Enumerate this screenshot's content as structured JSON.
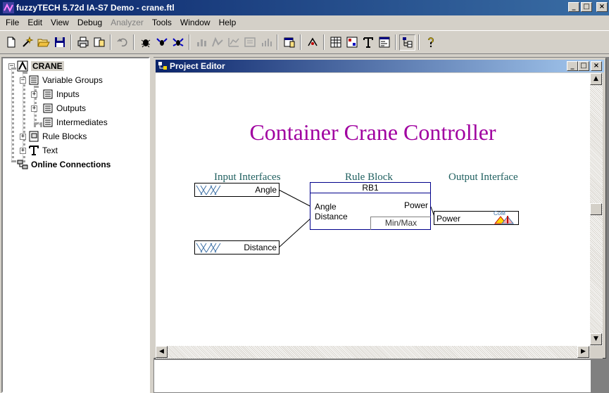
{
  "window": {
    "title": "fuzzyTECH 5.72d IA-S7 Demo - crane.ftl",
    "minimize": "_",
    "maximize": "□",
    "close": "×"
  },
  "menu": [
    {
      "label": "File",
      "enabled": true
    },
    {
      "label": "Edit",
      "enabled": true
    },
    {
      "label": "View",
      "enabled": true
    },
    {
      "label": "Debug",
      "enabled": true
    },
    {
      "label": "Analyzer",
      "enabled": false
    },
    {
      "label": "Tools",
      "enabled": true
    },
    {
      "label": "Window",
      "enabled": true
    },
    {
      "label": "Help",
      "enabled": true
    }
  ],
  "toolbar": {
    "icons": [
      "new-icon",
      "wizard-icon",
      "open-icon",
      "save-icon",
      "print-icon",
      "preview-icon",
      "undo-icon",
      "debug-icon",
      "debug-online-icon",
      "debug-serial-icon",
      "analyzer1-icon",
      "analyzer2-icon",
      "analyzer3-icon",
      "analyzer4-icon",
      "analyzer5-icon",
      "properties-icon",
      "compile-icon",
      "spreadsheet-icon",
      "matrix-icon",
      "text-icon",
      "editor-icon",
      "tree-icon",
      "help-icon"
    ]
  },
  "tree": {
    "root": "CRANE",
    "variable_groups": "Variable Groups",
    "inputs": "Inputs",
    "outputs": "Outputs",
    "intermediates": "Intermediates",
    "rule_blocks": "Rule Blocks",
    "text": "Text",
    "online_connections": "Online Connections"
  },
  "editor": {
    "title": "Project Editor",
    "heading": "Container Crane Controller",
    "labels": {
      "inputs": "Input Interfaces",
      "rule_block": "Rule Block",
      "output": "Output Interface"
    },
    "input_angle": "Angle",
    "input_distance": "Distance",
    "rule_block_name": "RB1",
    "rb_in1": "Angle",
    "rb_in2": "Distance",
    "rb_out1": "Power",
    "rb_operator": "Min/Max",
    "output_power": "Power",
    "output_method": "CoM"
  },
  "colors": {
    "title_gradient_start": "#0a246a",
    "heading": "#a000a0",
    "section_labels": "#1f5f5f",
    "rule_block_border": "#00008b",
    "membership_blue": "#3a6ea5"
  }
}
